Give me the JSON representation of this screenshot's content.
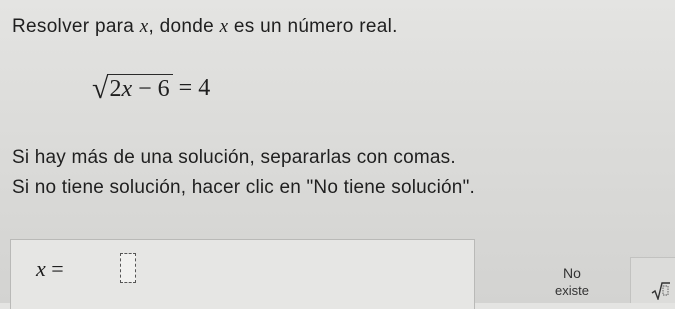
{
  "problem": {
    "prompt_text": "Resolver para x, donde x es un número real.",
    "equation": {
      "radical": "√",
      "radicand_coefficient": "2",
      "radicand_variable": "x",
      "radicand_rest": " − 6",
      "rhs": "= 4"
    }
  },
  "instructions": {
    "line1": "Si hay más de una solución, separarlas con comas.",
    "line2": "Si no tiene solución, hacer clic en \"No tiene solución\"."
  },
  "answer": {
    "variable": "x",
    "equals": " = ",
    "value": ""
  },
  "buttons": {
    "no_solution_line1": "No",
    "no_solution_line2": "existe",
    "sqrt_icon": "square-root-icon"
  }
}
